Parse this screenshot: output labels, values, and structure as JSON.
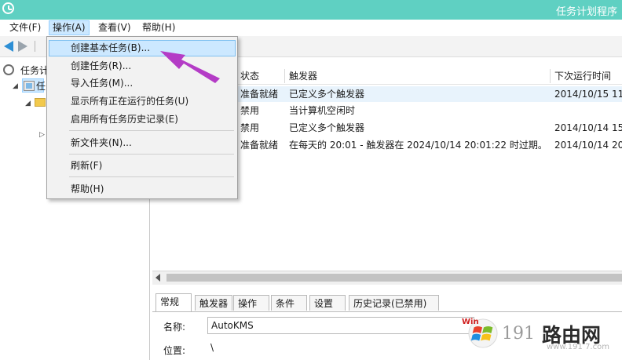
{
  "window": {
    "title": "任务计划程序"
  },
  "menubar": {
    "items": [
      {
        "label": "文件(F)"
      },
      {
        "label": "操作(A)"
      },
      {
        "label": "查看(V)"
      },
      {
        "label": "帮助(H)"
      }
    ],
    "active": "操作(A)"
  },
  "tree": {
    "root_label": "任务计",
    "library_label": "任",
    "expander_open": "◢",
    "expander_closed": "▷"
  },
  "action_menu": {
    "items": [
      {
        "label": "创建基本任务(B)..."
      },
      {
        "label": "创建任务(R)..."
      },
      {
        "label": "导入任务(M)..."
      },
      {
        "label": "显示所有正在运行的任务(U)"
      },
      {
        "label": "启用所有任务历史记录(E)"
      },
      {
        "label": "新文件夹(N)..."
      },
      {
        "label": "刷新(F)"
      },
      {
        "label": "帮助(H)"
      }
    ],
    "highlighted": "创建基本任务(B)..."
  },
  "task_list": {
    "columns": [
      "状态",
      "触发器",
      "下次运行时间"
    ],
    "rows": [
      {
        "status": "准备就绪",
        "trigger": "已定义多个触发器",
        "next_run": "2014/10/15 11"
      },
      {
        "status": "禁用",
        "trigger": "当计算机空闲时",
        "next_run": ""
      },
      {
        "status": "禁用",
        "trigger": "已定义多个触发器",
        "next_run": "2014/10/14 15"
      },
      {
        "status": "准备就绪",
        "trigger": "在每天的 20:01 - 触发器在 2024/10/14 20:01:22 时过期。",
        "next_run": "2014/10/14 20"
      }
    ]
  },
  "scrollbar": {
    "left_arrow": "<"
  },
  "detail_tabs": {
    "tabs": [
      "常规",
      "触发器",
      "操作",
      "条件",
      "设置",
      "历史记录(已禁用)"
    ],
    "selected": "常规"
  },
  "details": {
    "name_label": "名称:",
    "name_value": "AutoKMS",
    "location_label": "位置:",
    "location_value": "\\"
  },
  "watermark": {
    "number": "191",
    "site": "路由网",
    "url": "www.191 7.com",
    "win_text": "Win"
  },
  "colors": {
    "titlebar": "#5fd0c2",
    "menu_highlight": "#cce8ff",
    "annotation_arrow": "#b43cc6",
    "back_arrow": "#2d8fd5"
  },
  "icons": [
    "app-clock-icon",
    "back-arrow-icon",
    "forward-arrow-icon",
    "clock-icon",
    "library-icon",
    "folder-icon",
    "scroll-left-icon",
    "windows-logo-icon"
  ]
}
